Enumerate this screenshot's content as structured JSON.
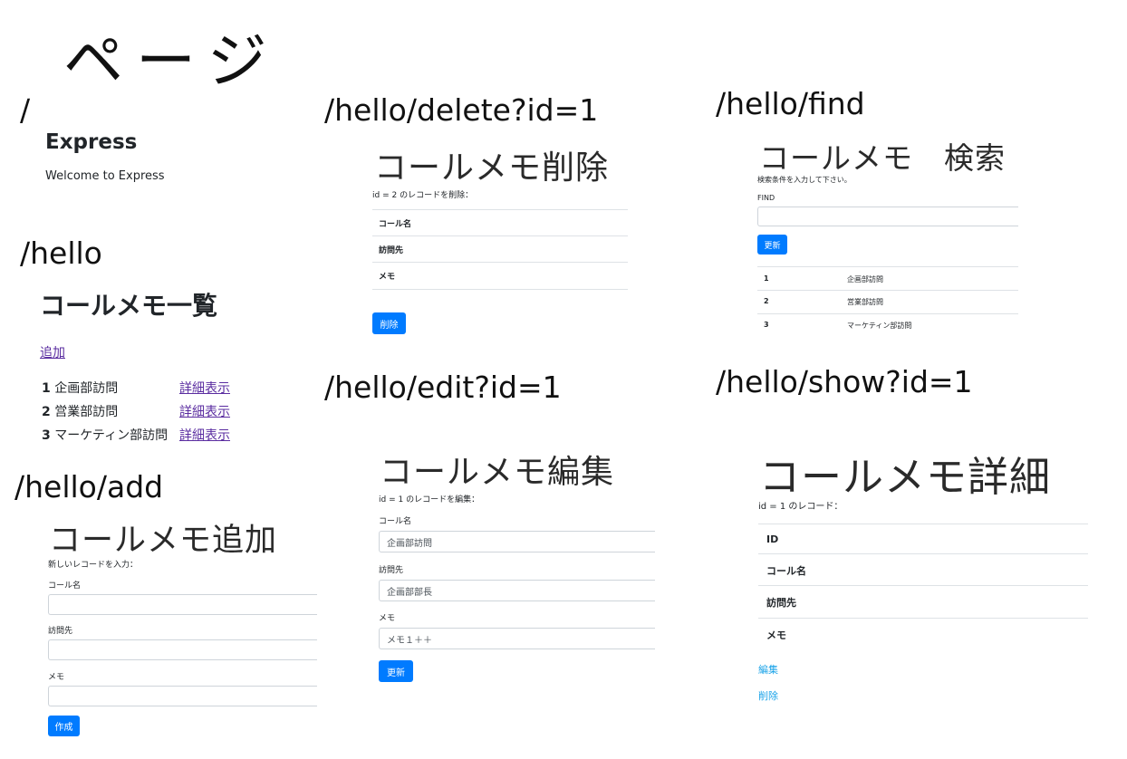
{
  "page_title": "ページ",
  "routes": {
    "root": "/",
    "hello": "/hello",
    "add": "/hello/add",
    "delete": "/hello/delete?id=1",
    "edit": "/hello/edit?id=1",
    "find": "/hello/find",
    "show": "/hello/show?id=1"
  },
  "express": {
    "title": "Express",
    "welcome": "Welcome to Express"
  },
  "list": {
    "title": "コールメモ一覧",
    "add_link": "追加",
    "items": [
      {
        "id": "1",
        "name": "企画部訪問",
        "link": "詳細表示"
      },
      {
        "id": "2",
        "name": "営業部訪問",
        "link": "詳細表示"
      },
      {
        "id": "3",
        "name": "マーケティン部訪問",
        "link": "詳細表示"
      }
    ]
  },
  "add": {
    "title": "コールメモ追加",
    "desc": "新しいレコードを入力：",
    "label_name": "コール名",
    "label_visit": "訪問先",
    "label_memo": "メモ",
    "button": "作成"
  },
  "delete": {
    "title": "コールメモ削除",
    "desc": "id = 2 のレコードを削除：",
    "row_name": "コール名",
    "row_visit": "訪問先",
    "row_memo": "メモ",
    "button": "削除"
  },
  "edit": {
    "title": "コールメモ編集",
    "desc": "id = 1 のレコードを編集：",
    "label_name": "コール名",
    "value_name": "企画部訪問",
    "label_visit": "訪問先",
    "value_visit": "企画部部長",
    "label_memo": "メモ",
    "value_memo": "メモ１＋＋",
    "button": "更新"
  },
  "find": {
    "title": "コールメモ　検索",
    "desc": "検索条件を入力して下さい。",
    "label": "FIND",
    "button": "更新",
    "rows": [
      {
        "id": "1",
        "name": "企画部訪問"
      },
      {
        "id": "2",
        "name": "営業部訪問"
      },
      {
        "id": "3",
        "name": "マーケティン部訪問"
      }
    ]
  },
  "show": {
    "title": "コールメモ詳細",
    "desc": "id = 1 のレコード：",
    "row_id": "ID",
    "row_name": "コール名",
    "row_visit": "訪問先",
    "row_memo": "メモ",
    "link_edit": "編集",
    "link_delete": "削除"
  }
}
